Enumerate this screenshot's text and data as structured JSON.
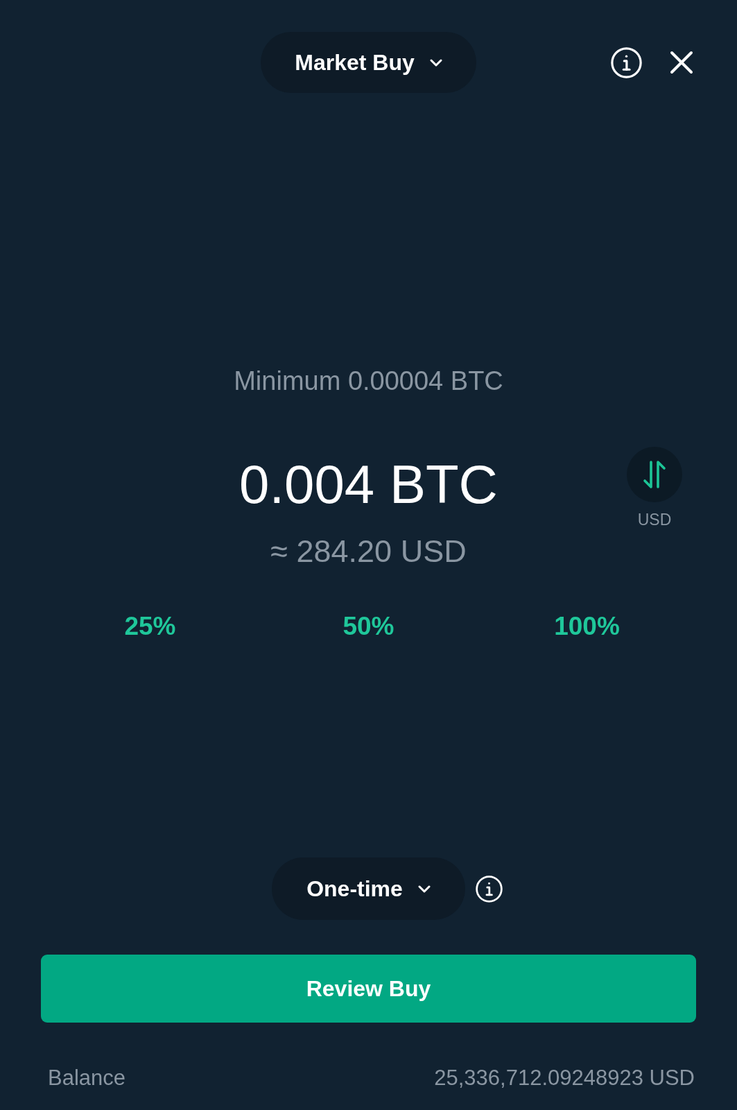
{
  "header": {
    "order_type": "Market Buy"
  },
  "amount": {
    "minimum": "Minimum 0.00004 BTC",
    "value": "0.004 BTC",
    "converted": "≈ 284.20 USD",
    "toggle_currency": "USD"
  },
  "percent_options": [
    {
      "label": "25%"
    },
    {
      "label": "50%"
    },
    {
      "label": "100%"
    }
  ],
  "frequency": {
    "label": "One-time"
  },
  "review_button": "Review Buy",
  "balance": {
    "label": "Balance",
    "value": "25,336,712.09248923 USD"
  }
}
